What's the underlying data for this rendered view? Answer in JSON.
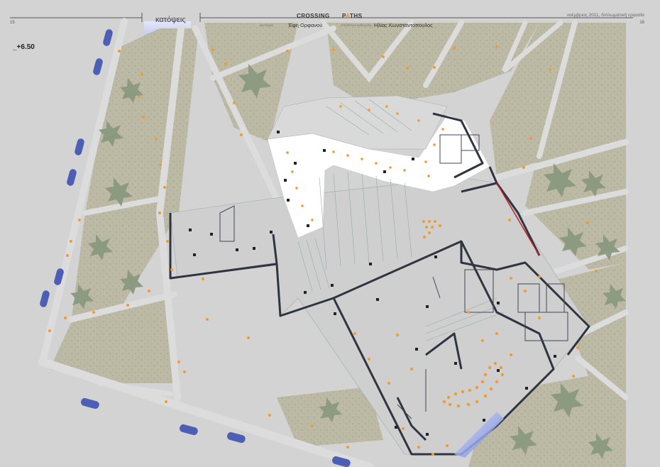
{
  "header": {
    "page_left": "15",
    "page_right": "16",
    "section_title": "κατόψεις",
    "project_title_1": "CROSSING",
    "project_title_2_pre": "P",
    "project_title_2_accent": "A",
    "project_title_2_post": "THS",
    "student_label": "φοιτήτρια",
    "student_name": "Έφη Ορφανού",
    "supervisor_label": "επιβλέπων καθηγητής",
    "supervisor_name": "Ηλίας Κωνσταντόπουλος",
    "date_note": "νοέμβριος 2011, διπλωματική εργασία"
  },
  "plan": {
    "level_label": "_+6.50"
  },
  "colors": {
    "background": "#d3d3d4",
    "road": "#dedede",
    "park": "#b9b6a2",
    "tree": "#86967e",
    "wall": "#2f3440",
    "furniture": "#f29a2e",
    "bus": "#4d5fb4",
    "red_line": "#c0202a",
    "water": "#6e87d8"
  }
}
